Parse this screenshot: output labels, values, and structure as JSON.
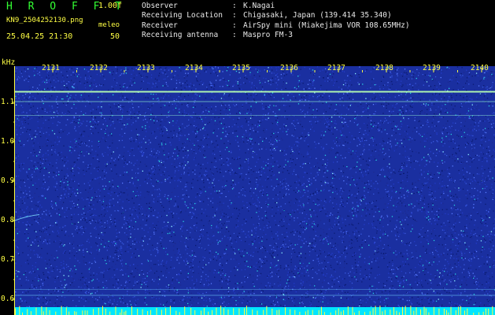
{
  "header": {
    "logo": "H R O F F T",
    "version": "1.00f",
    "filename": "KN9_2504252130.png",
    "meleo_label": "meleo",
    "datetime": "25.04.25 21:30",
    "meleo_value": "50",
    "info": [
      {
        "label": "Observer",
        "value": "K.Nagai"
      },
      {
        "label": "Receiving Location",
        "value": "Chigasaki, Japan (139.414 35.340)"
      },
      {
        "label": "Receiver",
        "value": "AirSpy mini (Miakejima VOR 108.65MHz)"
      },
      {
        "label": "Receiving antenna",
        "value": "Maspro FM-3"
      }
    ]
  },
  "axis": {
    "unit": "kHz",
    "y_ticks": [
      "1.1",
      "1.0",
      "0.9",
      "0.8",
      "0.7",
      "0.6"
    ],
    "x_ticks": [
      "2131",
      "2132",
      "2133",
      "2134",
      "2135",
      "2136",
      "2137",
      "2138",
      "2139",
      "2140"
    ]
  },
  "colors": {
    "background": "#000000",
    "spectrogram_base": "#1a2fa0",
    "label_yellow": "#ffff44",
    "logo_green": "#33ff33",
    "signal_line": "#88ddcc",
    "bottom_bar": "#00e5ff"
  }
}
